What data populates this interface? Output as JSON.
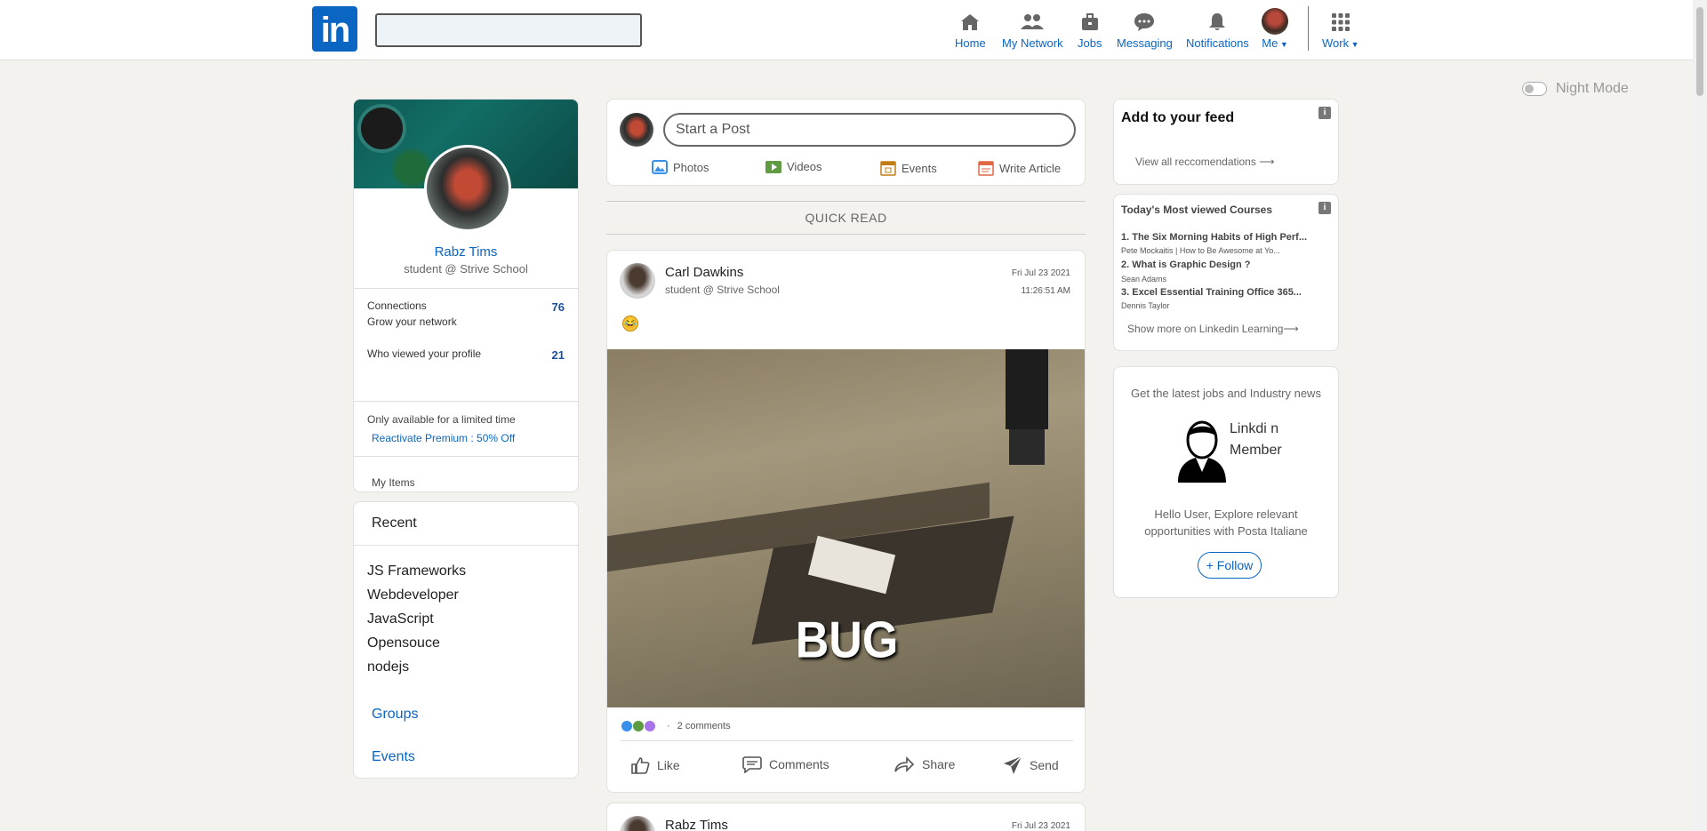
{
  "nav": {
    "logo": "in",
    "items": [
      {
        "label": "Home",
        "icon": "home-icon"
      },
      {
        "label": "My Network",
        "icon": "network-icon"
      },
      {
        "label": "Jobs",
        "icon": "briefcase-icon"
      },
      {
        "label": "Messaging",
        "icon": "chat-icon"
      },
      {
        "label": "Notifications",
        "icon": "bell-icon"
      },
      {
        "label": "Me",
        "icon": "avatar"
      },
      {
        "label": "Work",
        "icon": "grid-icon"
      }
    ]
  },
  "night_mode": {
    "label": "Night Mode",
    "enabled": false
  },
  "profile": {
    "name": "Rabz Tims",
    "subtitle": "student @ Strive School",
    "connections_label": "Connections",
    "connections_sub": "Grow your network",
    "connections_value": "76",
    "viewed_label": "Who viewed your profile",
    "viewed_value": "21",
    "premium_note": "Only available for a limited time",
    "premium_link": "Reactivate Premium : 50% Off",
    "my_items": "My Items"
  },
  "recent": {
    "title": "Recent",
    "items": [
      "JS Frameworks",
      "Webdeveloper",
      "JavaScript",
      "Opensouce",
      "nodejs"
    ],
    "groups": "Groups",
    "events": "Events"
  },
  "start_post": {
    "placeholder": "Start a Post",
    "actions": [
      {
        "label": "Photos",
        "icon": "photo-icon",
        "color": "#378fe9"
      },
      {
        "label": "Videos",
        "icon": "video-icon",
        "color": "#5f9b41"
      },
      {
        "label": "Events",
        "icon": "calendar-icon",
        "color": "#c37d16"
      },
      {
        "label": "Write Article",
        "icon": "article-icon",
        "color": "#e16745"
      }
    ]
  },
  "quick_read": "QUICK READ",
  "post": {
    "author": "Carl Dawkins",
    "subtitle": "student @ Strive School",
    "date": "Fri Jul 23 2021",
    "time": "11:26:51 AM",
    "image_caption": "BUG",
    "comments": "2 comments",
    "actions": [
      "Like",
      "Comments",
      "Share",
      "Send"
    ]
  },
  "post2": {
    "author": "Rabz Tims",
    "date": "Fri Jul 23 2021"
  },
  "feed_card": {
    "title": "Add to your feed",
    "link": "View all reccomendations"
  },
  "courses": {
    "title": "Today's Most viewed Courses",
    "items": [
      {
        "title": "1. The Six Morning Habits of High Perf...",
        "author": "Pete Mockaitis | How to Be Awesome at Yo..."
      },
      {
        "title": "2. What is Graphic Design ?",
        "author": "Sean Adams"
      },
      {
        "title": "3. Excel Essential Training Office 365...",
        "author": "Dennis Taylor"
      }
    ],
    "more": "Show more on Linkedin Learning"
  },
  "ad": {
    "headline": "Get the latest jobs and Industry news",
    "img_alt": "Linkdi n Member",
    "body": "Hello User, Explore relevant opportunities with Posta Italiane",
    "follow": "+ Follow"
  }
}
